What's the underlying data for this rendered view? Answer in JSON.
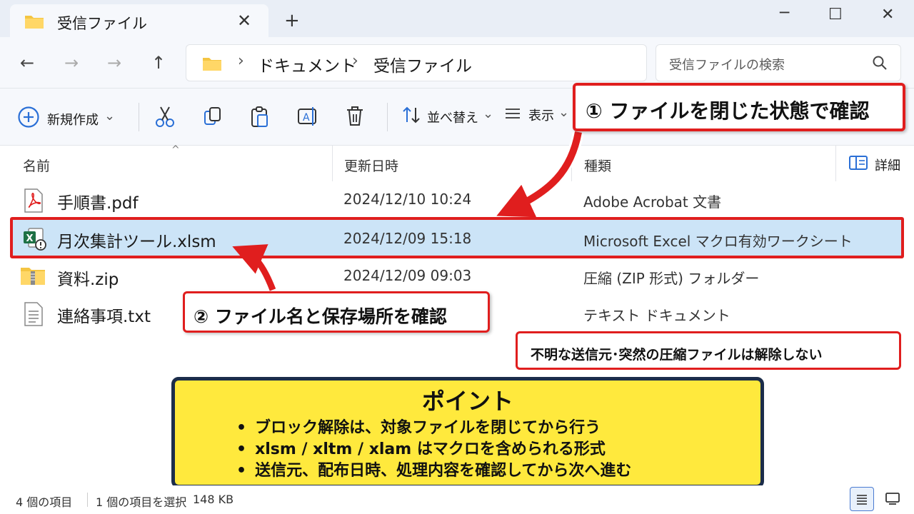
{
  "window": {
    "tab_title": "受信ファイル",
    "tab_close": "✕",
    "new_tab": "+",
    "minimize": "─",
    "maximize": "☐",
    "close": "✕"
  },
  "nav": {
    "back": "←",
    "forward": "→",
    "forward2": "→",
    "up": "↑",
    "breadcrumb": [
      "ドキュメント",
      "受信ファイル"
    ],
    "sep": "›",
    "search_placeholder": "受信ファイルの検索"
  },
  "commands": {
    "new": "新規作成",
    "sort": "並べ替え",
    "view": "表示",
    "details": "詳細",
    "chevron": "⌄"
  },
  "columns": {
    "name": "名前",
    "modified": "更新日時",
    "type": "種類",
    "sort_caret": "^"
  },
  "files": [
    {
      "name": "手順書.pdf",
      "date": "2024/12/10 10:24",
      "type": "Adobe Acrobat 文書",
      "icon": "pdf-icon"
    },
    {
      "name": "月次集計ツール.xlsm",
      "date": "2024/12/09 15:18",
      "type": "Microsoft Excel マクロ有効ワークシート",
      "icon": "excel-macro-icon"
    },
    {
      "name": "資料.zip",
      "date": "2024/12/09 09:03",
      "type": "圧縮 (ZIP 形式) フォルダー",
      "icon": "zip-folder-icon"
    },
    {
      "name": "連絡事項.txt",
      "date": "",
      "type": "テキスト ドキュメント",
      "icon": "text-file-icon"
    }
  ],
  "callouts": {
    "c1": "① ファイルを閉じた状態で確認",
    "c2": "② ファイル名と保存場所を確認",
    "c3": "不明な送信元･突然の圧縮ファイルは解除しない"
  },
  "point": {
    "title": "ポイント",
    "items": [
      "ブロック解除は、対象ファイルを閉じてから行う",
      "xlsm / xltm / xlam はマクロを含められる形式",
      "送信元、配布日時、処理内容を確認してから次へ進む"
    ]
  },
  "status": {
    "count": "4 個の項目",
    "selected": "1 個の項目を選択",
    "size": "148 KB"
  },
  "colors": {
    "accent_red": "#e01e1e",
    "selection": "#cce4f7",
    "point_bg": "#ffe93d",
    "point_border": "#1c2d4a"
  }
}
